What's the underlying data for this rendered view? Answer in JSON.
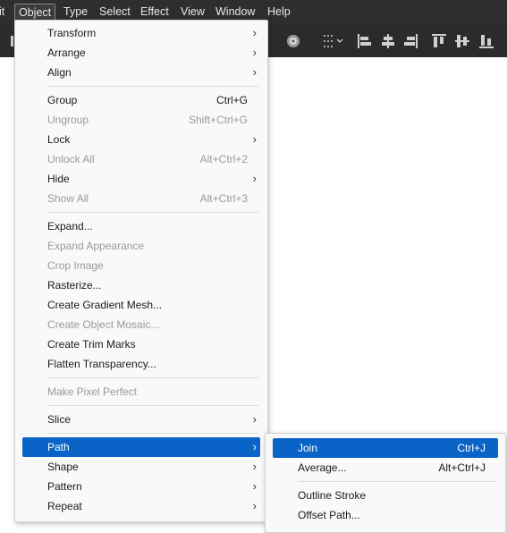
{
  "menubar": {
    "items": [
      "it",
      "Object",
      "Type",
      "Select",
      "Effect",
      "View",
      "Window",
      "Help"
    ]
  },
  "toolbar": {
    "icons": [
      "recolor-artwork-icon",
      "distribute-options-icon",
      "align-left-icon",
      "align-horizontal-center-icon",
      "align-right-icon",
      "align-top-icon",
      "align-vertical-center-icon",
      "align-bottom-icon"
    ]
  },
  "object_menu": {
    "items": [
      {
        "label": "Transform",
        "submenu": true
      },
      {
        "label": "Arrange",
        "submenu": true
      },
      {
        "label": "Align",
        "submenu": true
      },
      {
        "label": "Group",
        "shortcut": "Ctrl+G"
      },
      {
        "label": "Ungroup",
        "shortcut": "Shift+Ctrl+G",
        "disabled": true
      },
      {
        "label": "Lock",
        "submenu": true
      },
      {
        "label": "Unlock All",
        "shortcut": "Alt+Ctrl+2",
        "disabled": true
      },
      {
        "label": "Hide",
        "submenu": true
      },
      {
        "label": "Show All",
        "shortcut": "Alt+Ctrl+3",
        "disabled": true
      },
      {
        "label": "Expand..."
      },
      {
        "label": "Expand Appearance",
        "disabled": true
      },
      {
        "label": "Crop Image",
        "disabled": true
      },
      {
        "label": "Rasterize..."
      },
      {
        "label": "Create Gradient Mesh..."
      },
      {
        "label": "Create Object Mosaic...",
        "disabled": true
      },
      {
        "label": "Create Trim Marks"
      },
      {
        "label": "Flatten Transparency..."
      },
      {
        "label": "Make Pixel Perfect",
        "disabled": true
      },
      {
        "label": "Slice",
        "submenu": true
      },
      {
        "label": "Path",
        "submenu": true,
        "highlighted": true
      },
      {
        "label": "Shape",
        "submenu": true
      },
      {
        "label": "Pattern",
        "submenu": true
      },
      {
        "label": "Repeat",
        "submenu": true
      }
    ]
  },
  "path_submenu": {
    "items": [
      {
        "label": "Join",
        "shortcut": "Ctrl+J",
        "highlighted": true
      },
      {
        "label": "Average...",
        "shortcut": "Alt+Ctrl+J"
      },
      {
        "label": "Outline Stroke"
      },
      {
        "label": "Offset Path..."
      }
    ]
  },
  "colors": {
    "menubar_bg": "#2e2e2e",
    "menu_bg": "#f9f9f9",
    "highlight": "#0a64c8",
    "disabled_text": "#9a9a9a"
  }
}
